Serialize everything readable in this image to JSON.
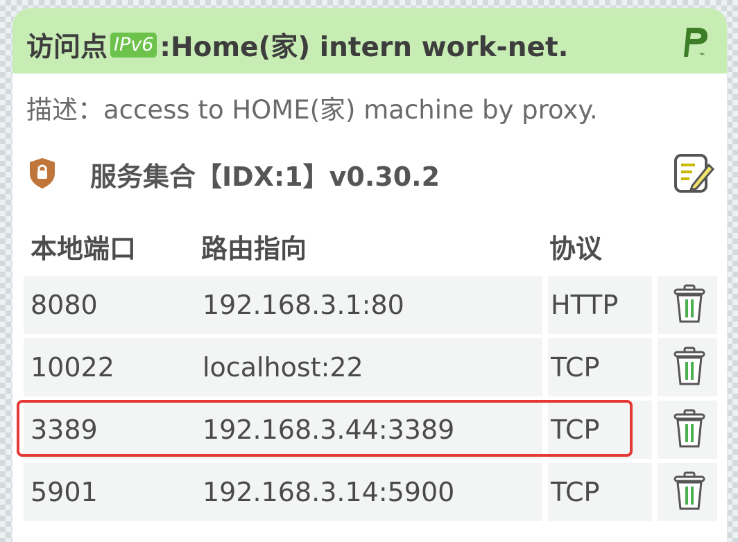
{
  "header": {
    "title_prefix": "访问点",
    "badge": "IPv6",
    "title_suffix": ":Home(家) intern work-net.",
    "bg_color": "#c8edb4"
  },
  "description": "描述：access to HOME(家) machine by proxy.",
  "service": {
    "title": "服务集合【IDX:1】v0.30.2",
    "icon": "shield-lock-icon",
    "edit_icon": "edit-note-icon"
  },
  "table": {
    "headers": [
      "本地端口",
      "路由指向",
      "协议"
    ],
    "rows": [
      {
        "port": "8080",
        "route": "192.168.3.1:80",
        "protocol": "HTTP"
      },
      {
        "port": "10022",
        "route": "localhost:22",
        "protocol": "TCP"
      },
      {
        "port": "3389",
        "route": "192.168.3.44:3389",
        "protocol": "TCP"
      },
      {
        "port": "5901",
        "route": "192.168.3.14:5900",
        "protocol": "TCP"
      }
    ],
    "row_action_icon": "trash-icon",
    "highlighted_row": 2,
    "highlight_color": "#e53935"
  }
}
